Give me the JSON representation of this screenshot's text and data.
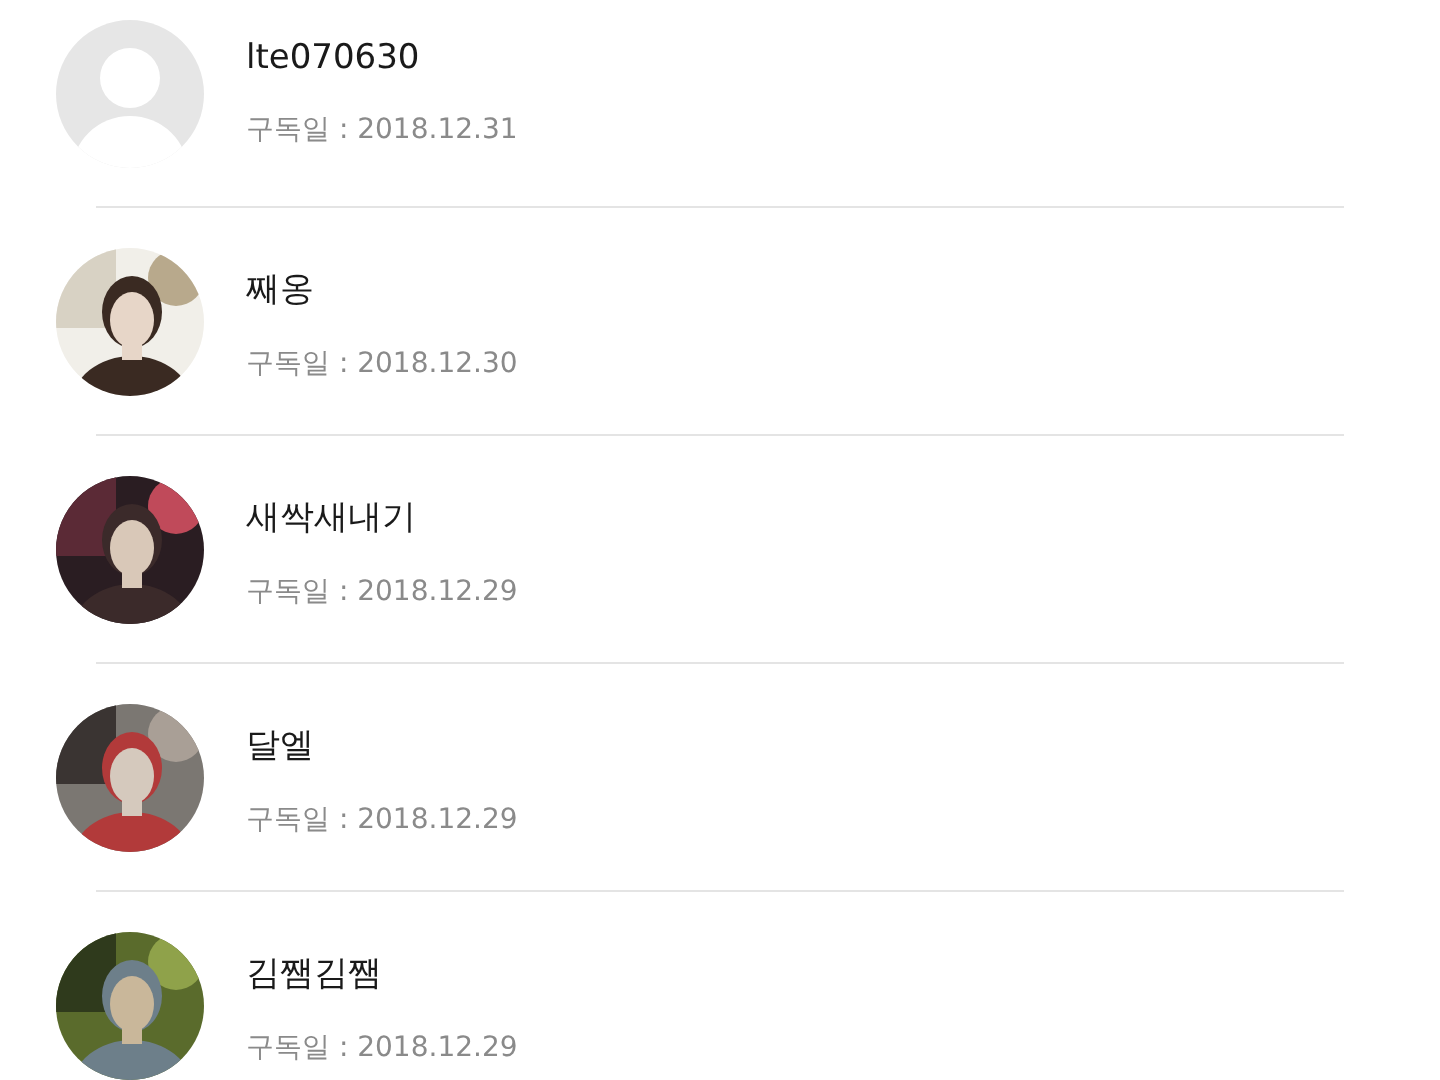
{
  "subscribers": [
    {
      "name": "lte070630",
      "date": "구독일 : 2018.12.31",
      "avatar": {
        "kind": "default"
      }
    },
    {
      "name": "째옹",
      "date": "구독일 : 2018.12.30"
    },
    {
      "name": "새싹새내기",
      "date": "구독일 : 2018.12.29"
    },
    {
      "name": "달엘",
      "date": "구독일 : 2018.12.29"
    },
    {
      "name": "김쨈김쨈",
      "date": "구독일 : 2018.12.29"
    }
  ]
}
